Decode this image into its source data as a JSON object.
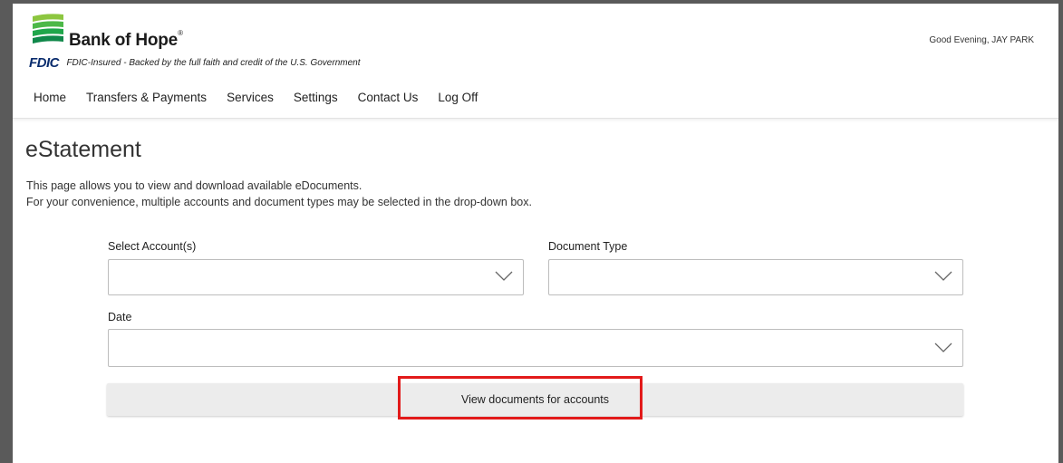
{
  "brand": {
    "name": "Bank of Hope",
    "registered_mark": "®",
    "fdic_mark": "FDIC",
    "fdic_text": "FDIC-Insured - Backed by the full faith and credit of the U.S. Government"
  },
  "greeting": "Good Evening, JAY PARK",
  "nav": {
    "items": [
      "Home",
      "Transfers & Payments",
      "Services",
      "Settings",
      "Contact Us",
      "Log Off"
    ]
  },
  "page": {
    "title": "eStatement",
    "desc_line1": "This page allows you to view and download available eDocuments.",
    "desc_line2": "For your convenience, multiple accounts and document types may be selected in the drop-down box."
  },
  "form": {
    "account_label": "Select Account(s)",
    "account_value": "",
    "doc_type_label": "Document Type",
    "doc_type_value": "",
    "date_label": "Date",
    "date_value": "",
    "submit_label": "View documents for accounts"
  },
  "colors": {
    "highlight": "#e21a1a",
    "logo_green": "#1fa64a",
    "logo_lime": "#8cc63f",
    "fdic_blue": "#0b2d6e"
  },
  "icons": {
    "dropdown": "chevron-down-icon",
    "logo": "bank-of-hope-logo"
  }
}
